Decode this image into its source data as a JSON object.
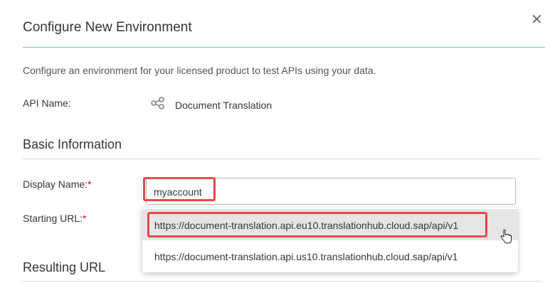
{
  "dialog": {
    "title": "Configure New Environment",
    "close_icon": "close-icon",
    "description": "Configure an environment for your licensed product to test APIs using your data."
  },
  "api": {
    "label": "API Name:",
    "icon": "share-icon",
    "value": "Document Translation"
  },
  "basic_info": {
    "heading": "Basic Information",
    "display_name": {
      "label": "Display Name:",
      "required_mark": "*",
      "value": "myaccount"
    },
    "starting_url": {
      "label": "Starting URL:",
      "required_mark": "*",
      "options": [
        "https://document-translation.api.eu10.translationhub.cloud.sap/api/v1",
        "https://document-translation.api.us10.translationhub.cloud.sap/api/v1"
      ],
      "highlighted_index": 0
    }
  },
  "resulting_url": {
    "heading": "Resulting URL"
  },
  "colors": {
    "highlight": "#e34a4a",
    "title_rule": "#7fb3c8",
    "required": "#ee0000"
  }
}
